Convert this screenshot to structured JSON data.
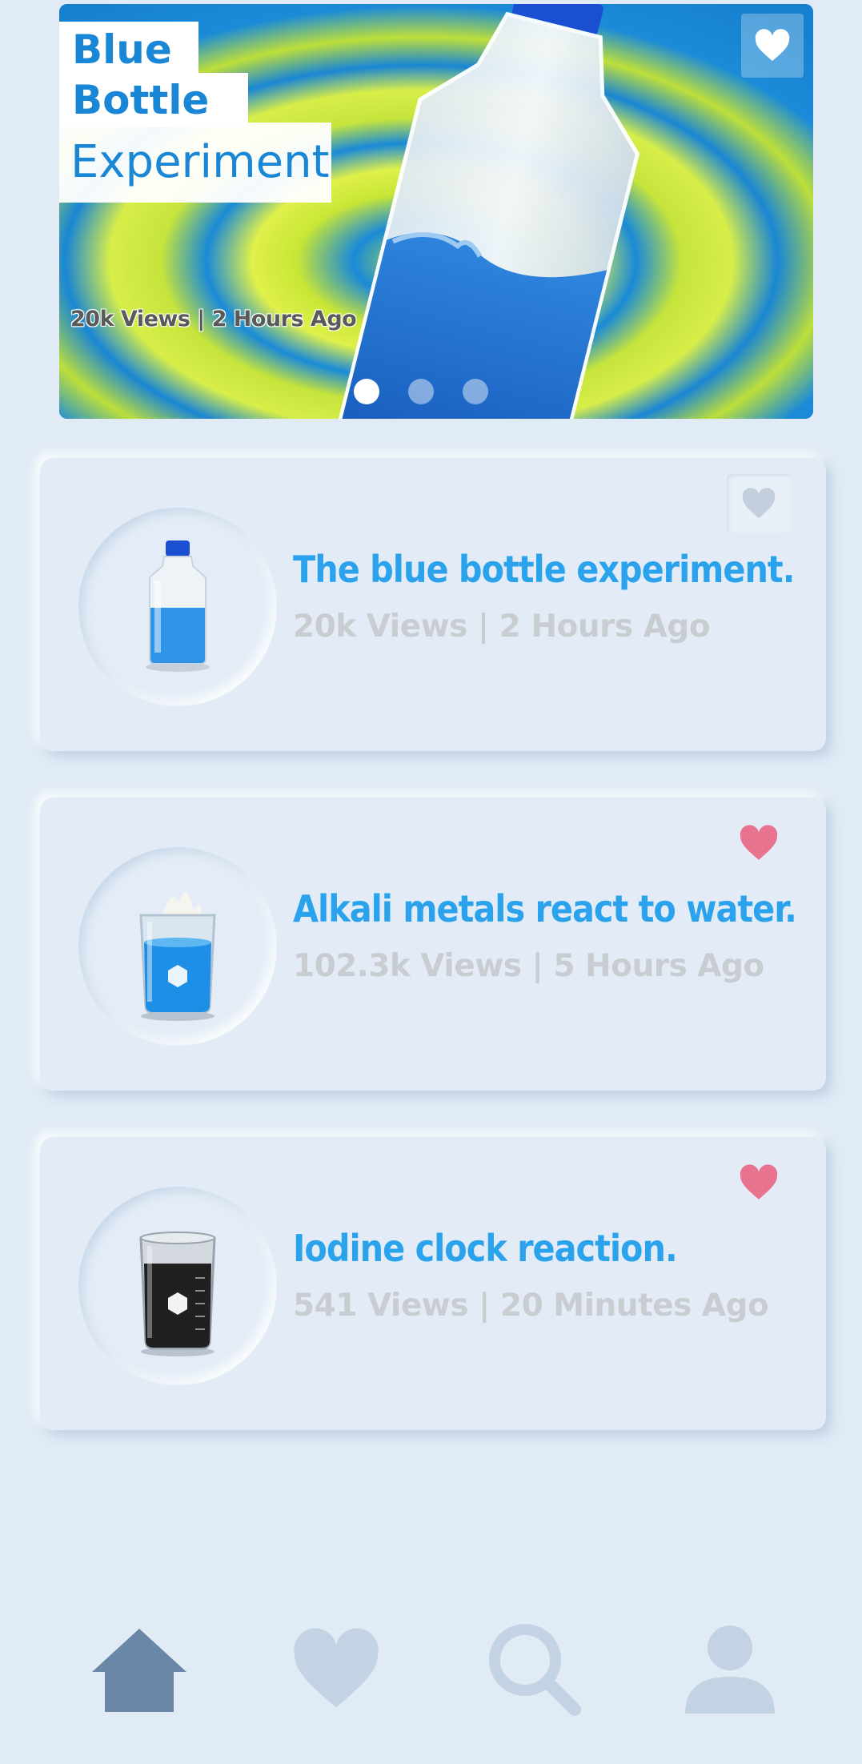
{
  "hero": {
    "title_line1": "Blue",
    "title_line2": "Bottle",
    "title_line3": "Experiment",
    "meta": "20k Views | 2 Hours Ago",
    "favorite_icon": "heart-icon",
    "slides": [
      {
        "active": true
      },
      {
        "active": false
      },
      {
        "active": false
      }
    ]
  },
  "experiments": [
    {
      "title": "The blue bottle experiment.",
      "meta": "20k Views | 2 Hours Ago",
      "favorited": false,
      "thumbnail": "water-bottle"
    },
    {
      "title": "Alkali metals react to water.",
      "meta": "102.3k Views | 5 Hours Ago",
      "favorited": true,
      "thumbnail": "beaker-blue"
    },
    {
      "title": "Iodine clock reaction.",
      "meta": "541 Views | 20 Minutes Ago",
      "favorited": true,
      "thumbnail": "beaker-black"
    }
  ],
  "colors": {
    "background": "#e1ebf6",
    "title_blue": "#2aa2ec",
    "meta_gray": "#c9cdd2",
    "heart_active": "#e8738f",
    "heart_inactive": "#c3cfdc",
    "nav_active": "#6a87a8",
    "nav_inactive": "#c3d3e4"
  },
  "bottom_nav": [
    {
      "icon": "home-icon",
      "active": true
    },
    {
      "icon": "heart-icon",
      "active": false
    },
    {
      "icon": "search-icon",
      "active": false
    },
    {
      "icon": "user-icon",
      "active": false
    }
  ]
}
